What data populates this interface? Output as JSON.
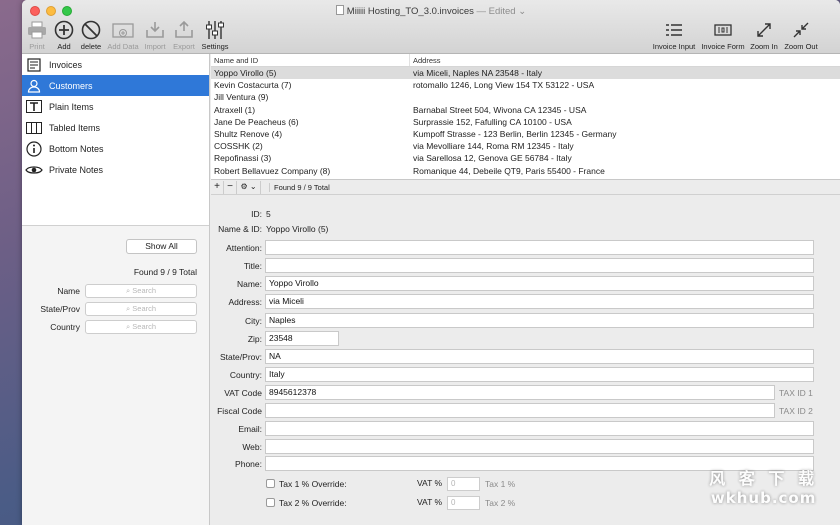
{
  "window": {
    "title": "Miiiii Hosting_TO_3.0.invoices",
    "edited": "— Edited ⌄"
  },
  "toolbar": {
    "left": [
      {
        "label": "Print",
        "icon": "printer-icon",
        "enabled": false
      },
      {
        "label": "Add",
        "icon": "plus-circle-icon",
        "enabled": true
      },
      {
        "label": "delete",
        "icon": "no-sign-icon",
        "enabled": true
      },
      {
        "label": "Add Data",
        "icon": "add-data-icon",
        "enabled": false
      },
      {
        "label": "Import",
        "icon": "import-icon",
        "enabled": false
      },
      {
        "label": "Export",
        "icon": "export-icon",
        "enabled": false
      },
      {
        "label": "Settings",
        "icon": "sliders-icon",
        "enabled": true
      }
    ],
    "right": [
      {
        "label": "Invoice Input",
        "icon": "list-icon"
      },
      {
        "label": "Invoice Form",
        "icon": "form-icon"
      },
      {
        "label": "Zoom In",
        "icon": "expand-icon"
      },
      {
        "label": "Zoom Out",
        "icon": "collapse-icon"
      }
    ]
  },
  "sidebar": {
    "items": [
      {
        "label": "Invoices",
        "icon": "invoice-icon"
      },
      {
        "label": "Customers",
        "icon": "person-icon"
      },
      {
        "label": "Plain Items",
        "icon": "text-icon"
      },
      {
        "label": "Tabled Items",
        "icon": "table-icon"
      },
      {
        "label": "Bottom Notes",
        "icon": "info-icon"
      },
      {
        "label": "Private Notes",
        "icon": "eye-icon"
      }
    ],
    "selected_index": 1,
    "show_all_label": "Show All",
    "found_total": "Found 9 / 9 Total",
    "filters": [
      {
        "label": "Name",
        "placeholder": "Search"
      },
      {
        "label": "State/Prov",
        "placeholder": "Search"
      },
      {
        "label": "Country",
        "placeholder": "Search"
      }
    ]
  },
  "table": {
    "columns": [
      "Name and ID",
      "Address"
    ],
    "rows": [
      [
        "Yoppo Virollo (5)",
        "via Miceli, Naples  NA  23548  - Italy"
      ],
      [
        "Kevin Costacurta (7)",
        "rotomallo 1246, Long View  154  TX  53122  - USA"
      ],
      [
        "Jill Ventura (9)",
        ""
      ],
      [
        "Atraxell (1)",
        "Barnabal Street 504, Wivona  CA  12345  - USA"
      ],
      [
        "Jane De Peacheus (6)",
        "Surprassie 152, Fafulling  CA  10100  - USA"
      ],
      [
        "Shultz Renove (4)",
        "Kumpoff Strasse - 123 Berlin, Berlin  12345  - Germany"
      ],
      [
        "COSSHK (2)",
        "via Mevolliare 144, Roma  RM  12345  - Italy"
      ],
      [
        "Repofinassi (3)",
        "via Sarellosa 12, Genova  GE  56784  - Italy"
      ],
      [
        "Robert Bellavuez Company (8)",
        "Romanique 44, Debeile QT9, Paris  55400  - France"
      ]
    ],
    "selected_index": 0,
    "footer": {
      "add": "+",
      "remove": "−",
      "gear": "⚙ ⌄",
      "found": "Found 9 / 9 Total"
    }
  },
  "detail": {
    "id_label": "ID:",
    "id_value": "5",
    "name_id_label": "Name & ID:",
    "name_id_value": "Yoppo Virollo (5)",
    "fields": [
      {
        "label": "Attention:",
        "value": ""
      },
      {
        "label": "Title:",
        "value": ""
      },
      {
        "label": "Name:",
        "value": "Yoppo Virollo"
      },
      {
        "label": "Address:",
        "value": "via Miceli"
      },
      {
        "label": "City:",
        "value": "Naples"
      },
      {
        "label": "Zip:",
        "value": "23548"
      },
      {
        "label": "State/Prov:",
        "value": "NA"
      },
      {
        "label": "Country:",
        "value": "Italy"
      },
      {
        "label": "VAT Code",
        "value": "8945612378",
        "suffix": "TAX ID 1"
      },
      {
        "label": "Fiscal Code",
        "value": "",
        "suffix": "TAX ID 2"
      },
      {
        "label": "Email:",
        "value": ""
      },
      {
        "label": "Web:",
        "value": ""
      },
      {
        "label": "Phone:",
        "value": ""
      }
    ],
    "tax_overrides": [
      {
        "label": "Tax 1 % Override:",
        "vat_label": "VAT %",
        "vat_placeholder": "0",
        "tax_placeholder": "Tax 1 %"
      },
      {
        "label": "Tax 2 % Override:",
        "vat_label": "VAT %",
        "vat_placeholder": "0",
        "tax_placeholder": "Tax 2 %"
      }
    ]
  },
  "watermark": {
    "line1": "风 客 下 载",
    "line2": "wkhub.com"
  },
  "colors": {
    "selection": "#2f78d8",
    "row_selected": "#dcdcdc"
  }
}
